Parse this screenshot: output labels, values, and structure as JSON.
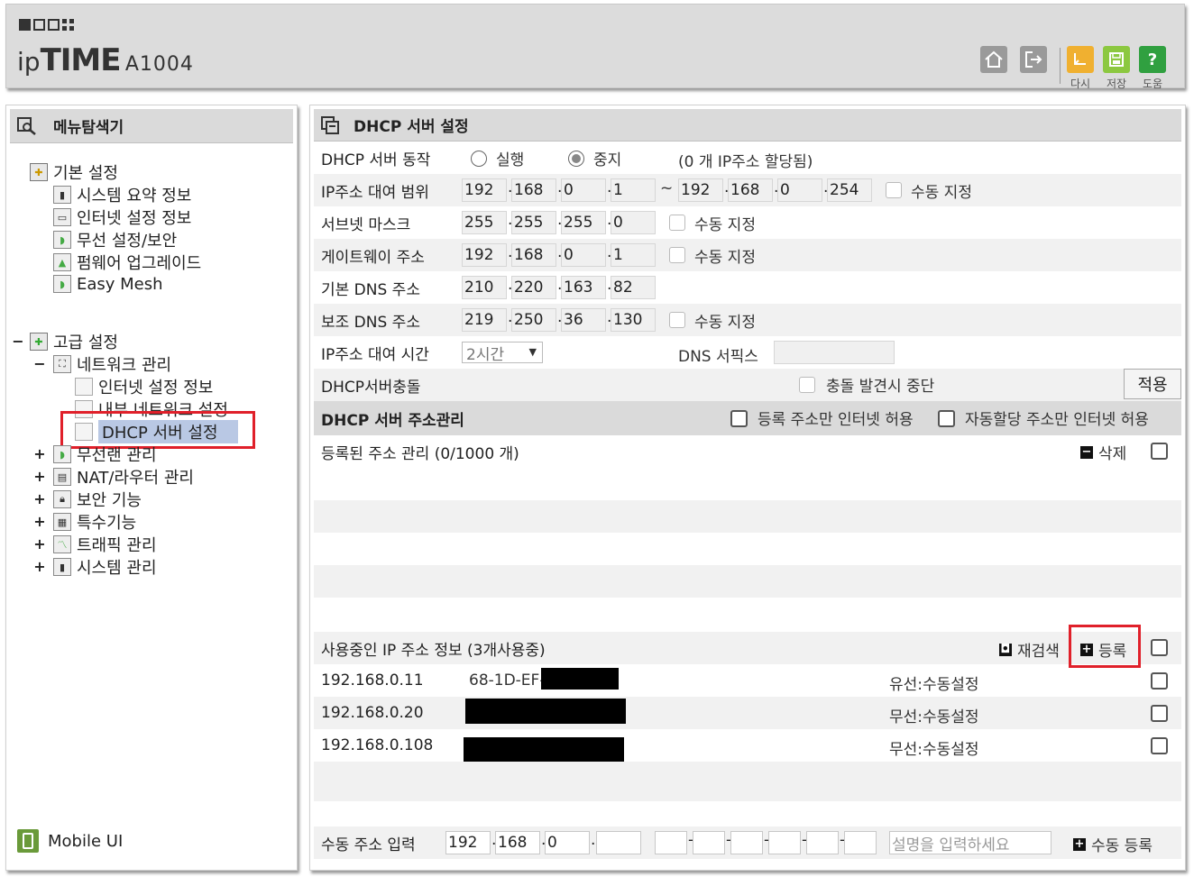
{
  "header": {
    "brand_ip": "ip",
    "brand_time": "TIME",
    "brand_model": "A1004",
    "buttons": [
      {
        "icon": "home-icon",
        "label": ""
      },
      {
        "icon": "logout-icon",
        "label": ""
      },
      {
        "icon": "undo-icon",
        "label": "다시"
      },
      {
        "icon": "save-icon",
        "label": "저장"
      },
      {
        "icon": "help-icon",
        "label": "도움"
      }
    ],
    "help_glyph": "?"
  },
  "sidebar": {
    "title": "메뉴탐색기",
    "basic": {
      "label": "기본 설정",
      "items": [
        "시스템 요약 정보",
        "인터넷 설정 정보",
        "무선 설정/보안",
        "펌웨어 업그레이드",
        "Easy Mesh"
      ]
    },
    "advanced": {
      "label": "고급 설정",
      "expander": "−",
      "network": {
        "label": "네트워크 관리",
        "expander": "−",
        "items": [
          "인터넷 설정 정보",
          "내부 네트워크 설정",
          "DHCP 서버 설정"
        ]
      },
      "groups": [
        {
          "expander": "+",
          "label": "무선랜 관리"
        },
        {
          "expander": "+",
          "label": "NAT/라우터 관리"
        },
        {
          "expander": "+",
          "label": "보안 기능"
        },
        {
          "expander": "+",
          "label": "특수기능"
        },
        {
          "expander": "+",
          "label": "트래픽 관리"
        },
        {
          "expander": "+",
          "label": "시스템 관리"
        }
      ]
    },
    "mobile_ui": "Mobile UI"
  },
  "main": {
    "title": "DHCP 서버 설정",
    "dhcp_action": {
      "label": "DHCP 서버 동작",
      "run": "실행",
      "stop": "중지",
      "selected": "중지",
      "status": "(0 개 IP주소 할당됨)"
    },
    "lease_range": {
      "label": "IP주소 대여 범위",
      "start": [
        "192",
        "168",
        "0",
        "1"
      ],
      "end": [
        "192",
        "168",
        "0",
        "254"
      ],
      "tilde": "~",
      "manual": "수동 지정"
    },
    "subnet": {
      "label": "서브넷 마스크",
      "value": [
        "255",
        "255",
        "255",
        "0"
      ],
      "manual": "수동 지정"
    },
    "gateway": {
      "label": "게이트웨이 주소",
      "value": [
        "192",
        "168",
        "0",
        "1"
      ],
      "manual": "수동 지정"
    },
    "dns1": {
      "label": "기본 DNS 주소",
      "value": [
        "210",
        "220",
        "163",
        "82"
      ]
    },
    "dns2": {
      "label": "보조 DNS 주소",
      "value": [
        "219",
        "250",
        "36",
        "130"
      ],
      "manual": "수동 지정"
    },
    "lease_time": {
      "label": "IP주소 대여 시간",
      "value": "2시간",
      "dns_suffix_label": "DNS 서픽스",
      "dns_suffix_value": ""
    },
    "conflict": {
      "label": "DHCP서버충돌",
      "stop_label": "충돌 발견시 중단",
      "apply": "적용"
    },
    "addr_mgmt": {
      "title": "DHCP 서버 주소관리",
      "reg_only": "등록 주소만 인터넷 허용",
      "auto_only": "자동할당 주소만 인터넷 허용"
    },
    "registered": {
      "label": "등록된 주소 관리 (0/1000 개)",
      "delete": "삭제"
    },
    "in_use": {
      "label": "사용중인 IP 주소 정보 (3개사용중)",
      "rescan": "재검색",
      "register": "등록",
      "rows": [
        {
          "ip": "192.168.0.11",
          "mac": "68-1D-EF-",
          "type": "유선:수동설정"
        },
        {
          "ip": "192.168.0.20",
          "mac": "",
          "type": "무선:수동설정"
        },
        {
          "ip": "192.168.0.108",
          "mac": "",
          "type": "무선:수동설정"
        }
      ]
    },
    "manual_entry": {
      "label": "수동 주소 입력",
      "ip": [
        "192",
        "168",
        "0",
        ""
      ],
      "mac": [
        "",
        "",
        "",
        "",
        "",
        ""
      ],
      "desc_placeholder": "설명을 입력하세요",
      "register": "수동 등록"
    }
  }
}
